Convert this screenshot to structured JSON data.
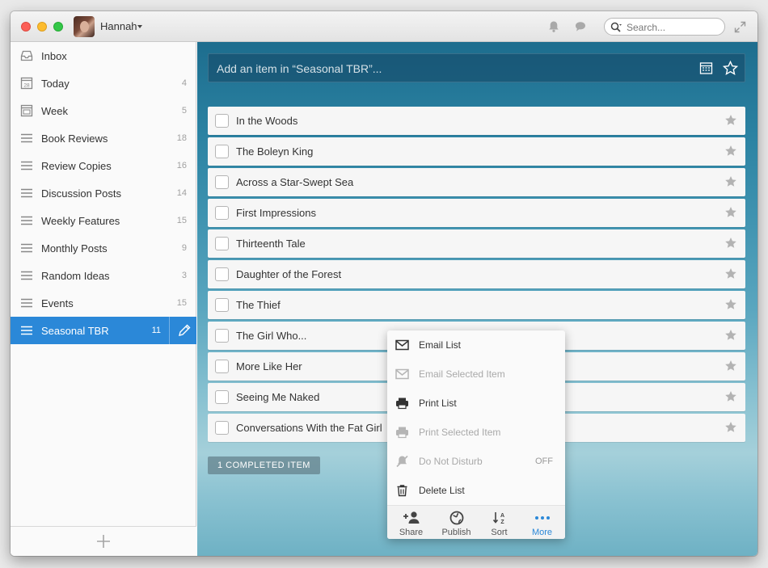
{
  "window": {
    "user": "Hannah",
    "search_placeholder": "Search..."
  },
  "sidebar": {
    "items": [
      {
        "label": "Inbox",
        "count": "",
        "icon": "inbox-icon"
      },
      {
        "label": "Today",
        "count": "4",
        "icon": "calendar-today-icon"
      },
      {
        "label": "Week",
        "count": "5",
        "icon": "calendar-week-icon"
      },
      {
        "label": "Book Reviews",
        "count": "18",
        "icon": "list-icon"
      },
      {
        "label": "Review Copies",
        "count": "16",
        "icon": "list-icon"
      },
      {
        "label": "Discussion Posts",
        "count": "14",
        "icon": "list-icon"
      },
      {
        "label": "Weekly Features",
        "count": "15",
        "icon": "list-icon"
      },
      {
        "label": "Monthly Posts",
        "count": "9",
        "icon": "list-icon"
      },
      {
        "label": "Random Ideas",
        "count": "3",
        "icon": "list-icon"
      },
      {
        "label": "Events",
        "count": "15",
        "icon": "list-icon"
      },
      {
        "label": "Seasonal TBR",
        "count": "11",
        "icon": "list-icon"
      }
    ],
    "today_icon_number": "28",
    "active_color": "#2b88d8"
  },
  "main": {
    "add_placeholder": "Add an item in “Seasonal TBR”...",
    "tasks": [
      "In the Woods",
      "The Boleyn King",
      "Across a Star-Swept Sea",
      "First Impressions",
      "Thirteenth Tale",
      "Daughter of the Forest",
      "The Thief",
      "The Girl Who...",
      "More Like Her",
      "Seeing Me Naked",
      "Conversations With the Fat Girl"
    ],
    "completed_label": "1 COMPLETED ITEM"
  },
  "menu": {
    "items": [
      {
        "label": "Email List",
        "disabled": false
      },
      {
        "label": "Email Selected Item",
        "disabled": true
      },
      {
        "label": "Print List",
        "disabled": false
      },
      {
        "label": "Print Selected Item",
        "disabled": true
      },
      {
        "label": "Do Not Disturb",
        "disabled": true,
        "value": "OFF"
      },
      {
        "label": "Delete List",
        "disabled": false
      }
    ],
    "bar": [
      {
        "label": "Share"
      },
      {
        "label": "Publish"
      },
      {
        "label": "Sort"
      },
      {
        "label": "More"
      }
    ]
  }
}
